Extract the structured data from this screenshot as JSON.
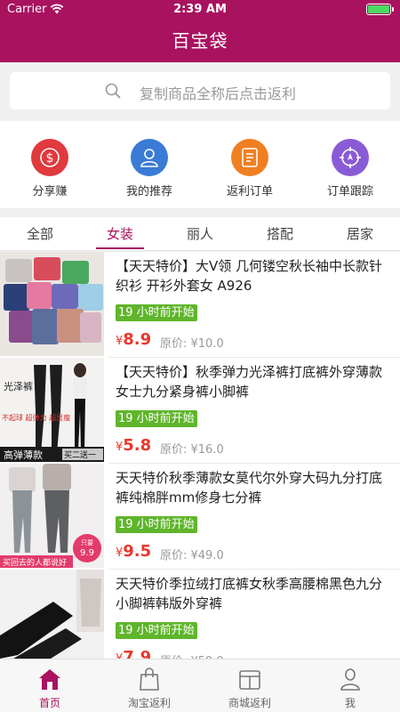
{
  "status_bar": {
    "carrier": "Carrier",
    "time": "2:39 AM"
  },
  "header": {
    "title": "百宝袋"
  },
  "search": {
    "placeholder": "复制商品全称后点击返利"
  },
  "shortcuts": [
    {
      "label": "分享赚",
      "icon": "dollar-icon",
      "color": "#e0393e"
    },
    {
      "label": "我的推荐",
      "icon": "user-icon",
      "color": "#3a7bd5"
    },
    {
      "label": "返利订单",
      "icon": "order-icon",
      "color": "#f07f22"
    },
    {
      "label": "订单跟踪",
      "icon": "compass-icon",
      "color": "#8a5bd6"
    }
  ],
  "tabs": [
    "全部",
    "女装",
    "丽人",
    "搭配",
    "居家"
  ],
  "active_tab": "女装",
  "products": [
    {
      "title": "【天天特价】大V领 几何镂空秋长袖中长款针织衫 开衫外套女 A926",
      "badge": "19 小时前开始",
      "currency": "¥",
      "price": "8.9",
      "original_price": "原价: ¥10.0"
    },
    {
      "title": "【天天特价】秋季弹力光泽裤打底裤外穿薄款女士九分紧身裤小脚裤",
      "badge": "19 小时前开始",
      "currency": "¥",
      "price": "5.8",
      "original_price": "原价: ¥16.0"
    },
    {
      "title": "天天特价秋季薄款女莫代尔外穿大码九分打底裤纯棉胖mm修身七分裤",
      "badge": "19 小时前开始",
      "currency": "¥",
      "price": "9.5",
      "original_price": "原价: ¥49.0"
    },
    {
      "title": "天天特价季拉绒打底裤女秋季高腰棉黑色九分小脚裤韩版外穿裤",
      "badge": "19 小时前开始",
      "currency": "¥",
      "price": "7.9",
      "original_price": "原价: ¥59.0"
    }
  ],
  "thumb_text": {
    "p2_side": "光泽裤",
    "p2_mid": "不起球 超弹力 超显瘦",
    "p2_banner": "高弹薄款",
    "p2_promo": "买二送一",
    "p3_banner": "买回去的人都说好",
    "p3_badge_top": "只要",
    "p3_badge_price": "9.9"
  },
  "tabbar": [
    {
      "label": "首页",
      "icon": "home-icon",
      "active": true
    },
    {
      "label": "淘宝返利",
      "icon": "shopping-bag-icon",
      "active": false
    },
    {
      "label": "商城返利",
      "icon": "mall-icon",
      "active": false
    },
    {
      "label": "我",
      "icon": "profile-icon",
      "active": false
    }
  ],
  "colors": {
    "brand": "#a8125f",
    "badge": "#5fb52b",
    "price": "#e8382b"
  }
}
